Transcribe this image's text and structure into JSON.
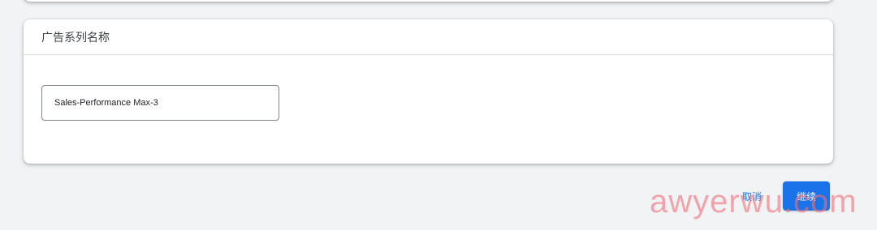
{
  "card": {
    "title": "广告系列名称",
    "name_field": {
      "value": "Sales-Performance Max-3"
    }
  },
  "actions": {
    "cancel_label": "取消",
    "continue_label": "继续"
  },
  "watermark": {
    "text": "awyerwu.com"
  },
  "colors": {
    "page_background": "#f1f3f4",
    "card_background": "#ffffff",
    "primary": "#1a73e8",
    "watermark": "#f06e78"
  }
}
